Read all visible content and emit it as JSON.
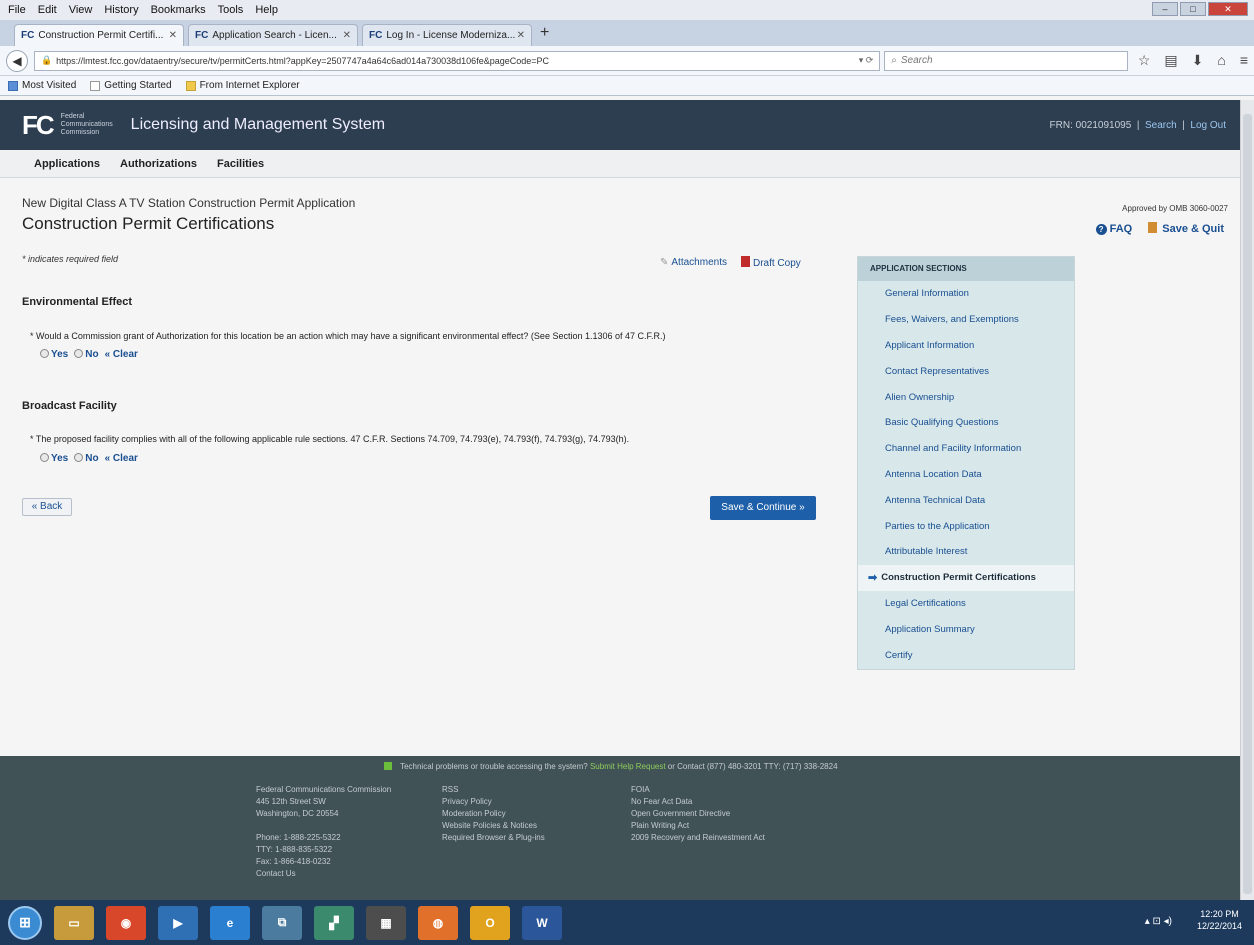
{
  "browser": {
    "menu": [
      "File",
      "Edit",
      "View",
      "History",
      "Bookmarks",
      "Tools",
      "Help"
    ],
    "tabs": [
      {
        "label": "Construction Permit Certifi..."
      },
      {
        "label": "Application Search - Licen..."
      },
      {
        "label": "Log In - License Moderniza..."
      }
    ],
    "tab_logo": "FC",
    "url": "https://lmtest.fcc.gov/dataentry/secure/tv/permitCerts.html?appKey=2507747a4a64c6ad014a730038d106fe&pageCode=PC",
    "search_placeholder": "Search",
    "bookmarks": [
      "Most Visited",
      "Getting Started",
      "From Internet Explorer"
    ]
  },
  "header": {
    "logo": "FC",
    "logo_sub": "Federal Communications Commission",
    "system_title": "Licensing and Management System",
    "frn": "FRN: 0021091095",
    "search_link": "Search",
    "logout_link": "Log Out"
  },
  "subnav": [
    "Applications",
    "Authorizations",
    "Facilities"
  ],
  "page": {
    "subtitle": "New Digital Class A TV Station Construction Permit Application",
    "title": "Construction Permit Certifications",
    "omb": "Approved by OMB 3060-0027",
    "faq": "FAQ",
    "save_quit": "Save & Quit",
    "required_note": "* indicates required field",
    "attachments": "Attachments",
    "draft_copy": "Draft Copy"
  },
  "env": {
    "title": "Environmental Effect",
    "question": "* Would a Commission grant of Authorization for this location be an action which may have a significant environmental effect? (See Section 1.1306 of 47 C.F.R.)",
    "yes": "Yes",
    "no": "No",
    "clear": "« Clear"
  },
  "broadcast": {
    "title": "Broadcast Facility",
    "question": "* The proposed facility complies with all of the following applicable rule sections. 47 C.F.R. Sections 74.709, 74.793(e), 74.793(f), 74.793(g), 74.793(h).",
    "yes": "Yes",
    "no": "No",
    "clear": "« Clear"
  },
  "buttons": {
    "back": "« Back",
    "save_continue": "Save & Continue »"
  },
  "sections": {
    "heading": "APPLICATION SECTIONS",
    "items": [
      "General Information",
      "Fees, Waivers, and Exemptions",
      "Applicant Information",
      "Contact Representatives",
      "Alien Ownership",
      "Basic Qualifying Questions",
      "Channel and Facility Information",
      "Antenna Location Data",
      "Antenna Technical Data",
      "Parties to the Application",
      "Attributable Interest",
      "Construction Permit Certifications",
      "Legal Certifications",
      "Application Summary",
      "Certify"
    ],
    "current_index": 11
  },
  "footer": {
    "top_text": "Technical problems or trouble accessing the system?",
    "help_link": "Submit Help Request",
    "contact": "or Contact (877) 480-3201 TTY: (717) 338-2824",
    "col1": [
      "Federal Communications Commission",
      "445 12th Street SW",
      "Washington, DC 20554",
      "",
      "Phone: 1-888-225-5322",
      "TTY: 1-888-835-5322",
      "Fax: 1-866-418-0232",
      "Contact Us"
    ],
    "col2": [
      "RSS",
      "Privacy Policy",
      "Moderation Policy",
      "Website Policies & Notices",
      "Required Browser & Plug-ins"
    ],
    "col3": [
      "FOIA",
      "No Fear Act Data",
      "Open Government Directive",
      "Plain Writing Act",
      "2009 Recovery and Reinvestment Act"
    ]
  },
  "taskbar": {
    "time": "12:20 PM",
    "date": "12/22/2014"
  },
  "colors": {
    "header_bg": "#2d3e50",
    "link_blue": "#1a4f91",
    "button_blue": "#1d5fa8",
    "sections_bg": "#d7e7ea",
    "footer_bg": "#415256"
  }
}
